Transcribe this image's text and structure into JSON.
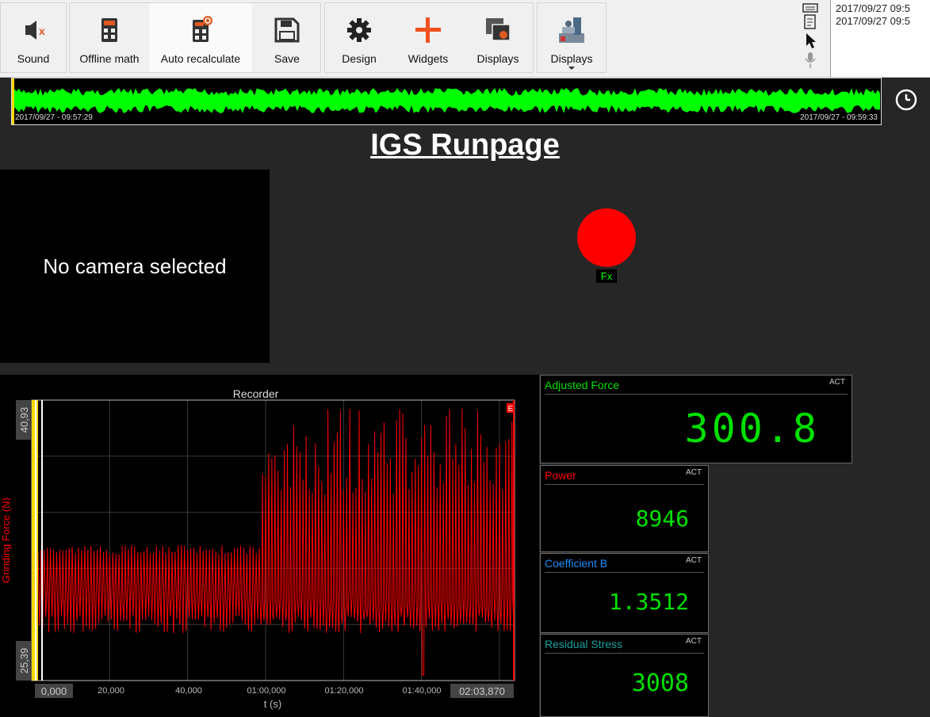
{
  "toolbar": {
    "sound_label": "Sound",
    "offline_math_label": "Offline math",
    "auto_recalculate_label": "Auto recalculate",
    "save_label": "Save",
    "design_label": "Design",
    "widgets_label": "Widgets",
    "displays_label": "Displays",
    "displays2_label": "Displays"
  },
  "log": {
    "entries": [
      "2017/09/27 09:5",
      "2017/09/27 09:5"
    ]
  },
  "overview": {
    "start_time": "2017/09/27 - 09:57:29",
    "end_time": "2017/09/27 - 09:59:33",
    "trace_color": "#00ff00"
  },
  "page": {
    "title": "IGS Runpage"
  },
  "camera": {
    "message": "No camera selected"
  },
  "indicator": {
    "label": "Fx",
    "color": "#ff0000"
  },
  "recorder": {
    "title": "Recorder",
    "y_label": "Grinding Force (N)",
    "y_max_label": "40,93",
    "y_min_label": "25,39",
    "x_label": "t (s)",
    "x_ticks": [
      "0,000",
      "20,000",
      "40,000",
      "01:00,000",
      "01:20,000",
      "01:40,000",
      "02:03,870"
    ],
    "marker_e": "E"
  },
  "chart_data": {
    "type": "line",
    "title": "Recorder",
    "xlabel": "t (s)",
    "ylabel": "Grinding Force (N)",
    "xlim": [
      0,
      123.87
    ],
    "ylim": [
      25.39,
      40.93
    ],
    "x_ticks": [
      "0,000",
      "20,000",
      "40,000",
      "01:00,000",
      "01:20,000",
      "01:40,000",
      "02:03,870"
    ],
    "grid": true,
    "series": [
      {
        "color": "#ff0000",
        "segments": [
          {
            "x": [
              0,
              59
            ],
            "baseline": 30.3,
            "peak_high": 32.9,
            "peak_low": 28.0
          },
          {
            "x": [
              59,
              123.87
            ],
            "baseline": 29.8,
            "peak_high": 40.5,
            "peak_low": 28.0
          }
        ],
        "dip": {
          "x": 100.5,
          "y": 25.7
        }
      }
    ]
  },
  "panels": {
    "adjusted_force": {
      "title": "Adjusted Force",
      "badge": "ACT",
      "value": "300.8",
      "title_color": "#00e000"
    },
    "power": {
      "title": "Power",
      "badge": "ACT",
      "value": "8946",
      "title_color": "#ff0000"
    },
    "coefficient_b": {
      "title": "Coefficient B",
      "badge": "ACT",
      "value": "1.3512",
      "title_color": "#1e90ff"
    },
    "residual_stress": {
      "title": "Residual Stress",
      "badge": "ACT",
      "value": "3008",
      "title_color": "#1aa0a0"
    }
  }
}
